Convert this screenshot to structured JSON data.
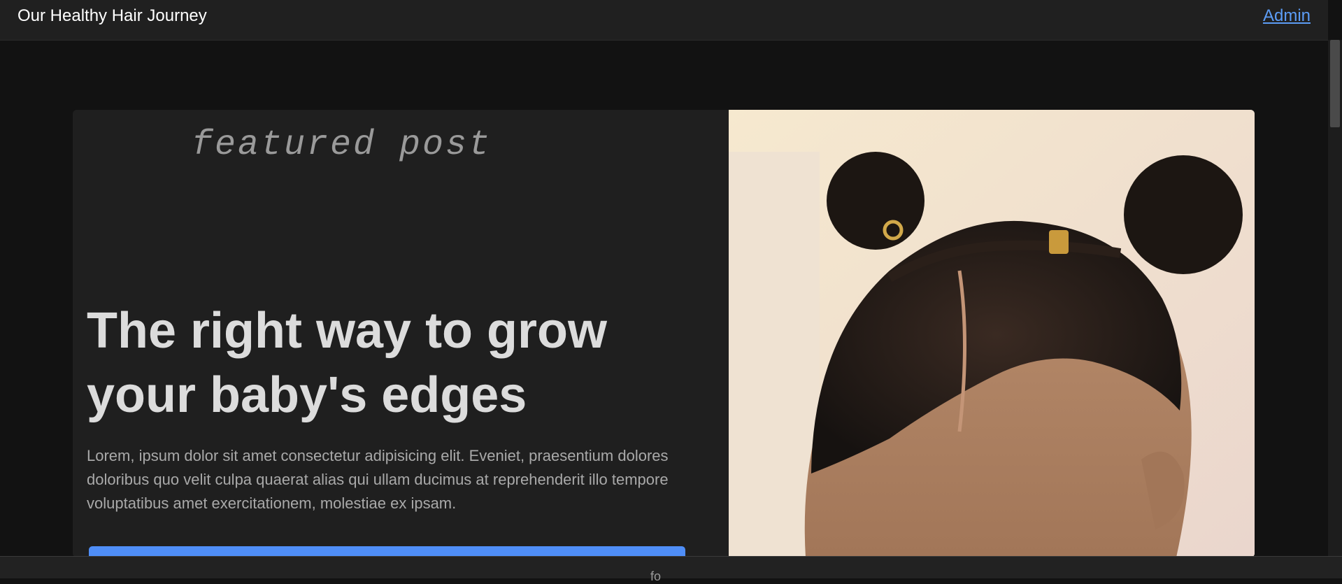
{
  "nav": {
    "brand": "Our Healthy Hair Journey",
    "admin_label": "Admin"
  },
  "featured": {
    "kicker": "featured post",
    "title": "The right way to grow your baby's edges",
    "excerpt": "Lorem, ipsum dolor sit amet consectetur adipisicing elit. Eveniet, praesentium dolores doloribus quo velit culpa quaerat alias qui ullam ducimus at reprehenderit illo tempore voluptatibus amet exercitationem, molestiae ex ipsam."
  },
  "footer": {
    "text": "fo"
  },
  "colors": {
    "accent": "#4f8ef7",
    "link": "#5c9cf5",
    "background": "#121212",
    "card": "#1f1f1f"
  }
}
